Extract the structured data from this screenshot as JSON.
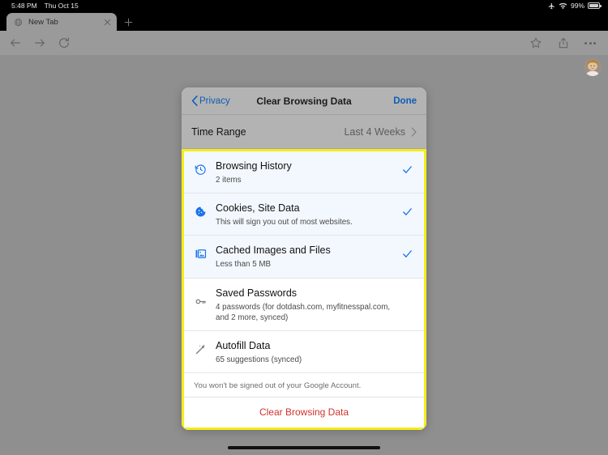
{
  "status_bar": {
    "time": "5:48 PM",
    "date": "Thu Oct 15",
    "battery_percent": "99%",
    "icons": [
      "airplane-mode-icon",
      "wifi-icon",
      "battery-icon"
    ]
  },
  "tab_strip": {
    "tab": {
      "title": "New Tab",
      "favicon": "globe-icon",
      "close": "close-icon"
    },
    "new_tab_button": "new-tab-plus-icon"
  },
  "toolbar": {
    "back": "back-arrow-icon",
    "forward": "forward-arrow-icon",
    "reload": "reload-icon",
    "bookmark": "star-icon",
    "share": "share-icon",
    "menu": "more-dots-icon"
  },
  "profile": {
    "avatar": "profile-avatar"
  },
  "sheet": {
    "back_label": "Privacy",
    "title": "Clear Browsing Data",
    "done_label": "Done",
    "time_range": {
      "label": "Time Range",
      "value": "Last 4 Weeks"
    },
    "options": [
      {
        "icon": "history-clock-icon",
        "title": "Browsing History",
        "subtitle": "2 items",
        "checked": true
      },
      {
        "icon": "cookie-icon",
        "title": "Cookies, Site Data",
        "subtitle": "This will sign you out of most websites.",
        "checked": true
      },
      {
        "icon": "cached-image-icon",
        "title": "Cached Images and Files",
        "subtitle": "Less than 5 MB",
        "checked": true
      },
      {
        "icon": "key-icon",
        "title": "Saved Passwords",
        "subtitle": "4 passwords (for dotdash.com, myfitnesspal.com, and 2 more, synced)",
        "checked": false
      },
      {
        "icon": "magic-wand-icon",
        "title": "Autofill Data",
        "subtitle": "65 suggestions (synced)",
        "checked": false
      }
    ],
    "note": "You won't be signed out of your Google Account.",
    "cta_label": "Clear Browsing Data"
  },
  "colors": {
    "accent_blue": "#1a73e8",
    "link_blue": "#0d5db5",
    "danger_red": "#d0342c",
    "highlight_yellow": "#f5ed1c",
    "backdrop_gray": "#8f8f8f"
  }
}
